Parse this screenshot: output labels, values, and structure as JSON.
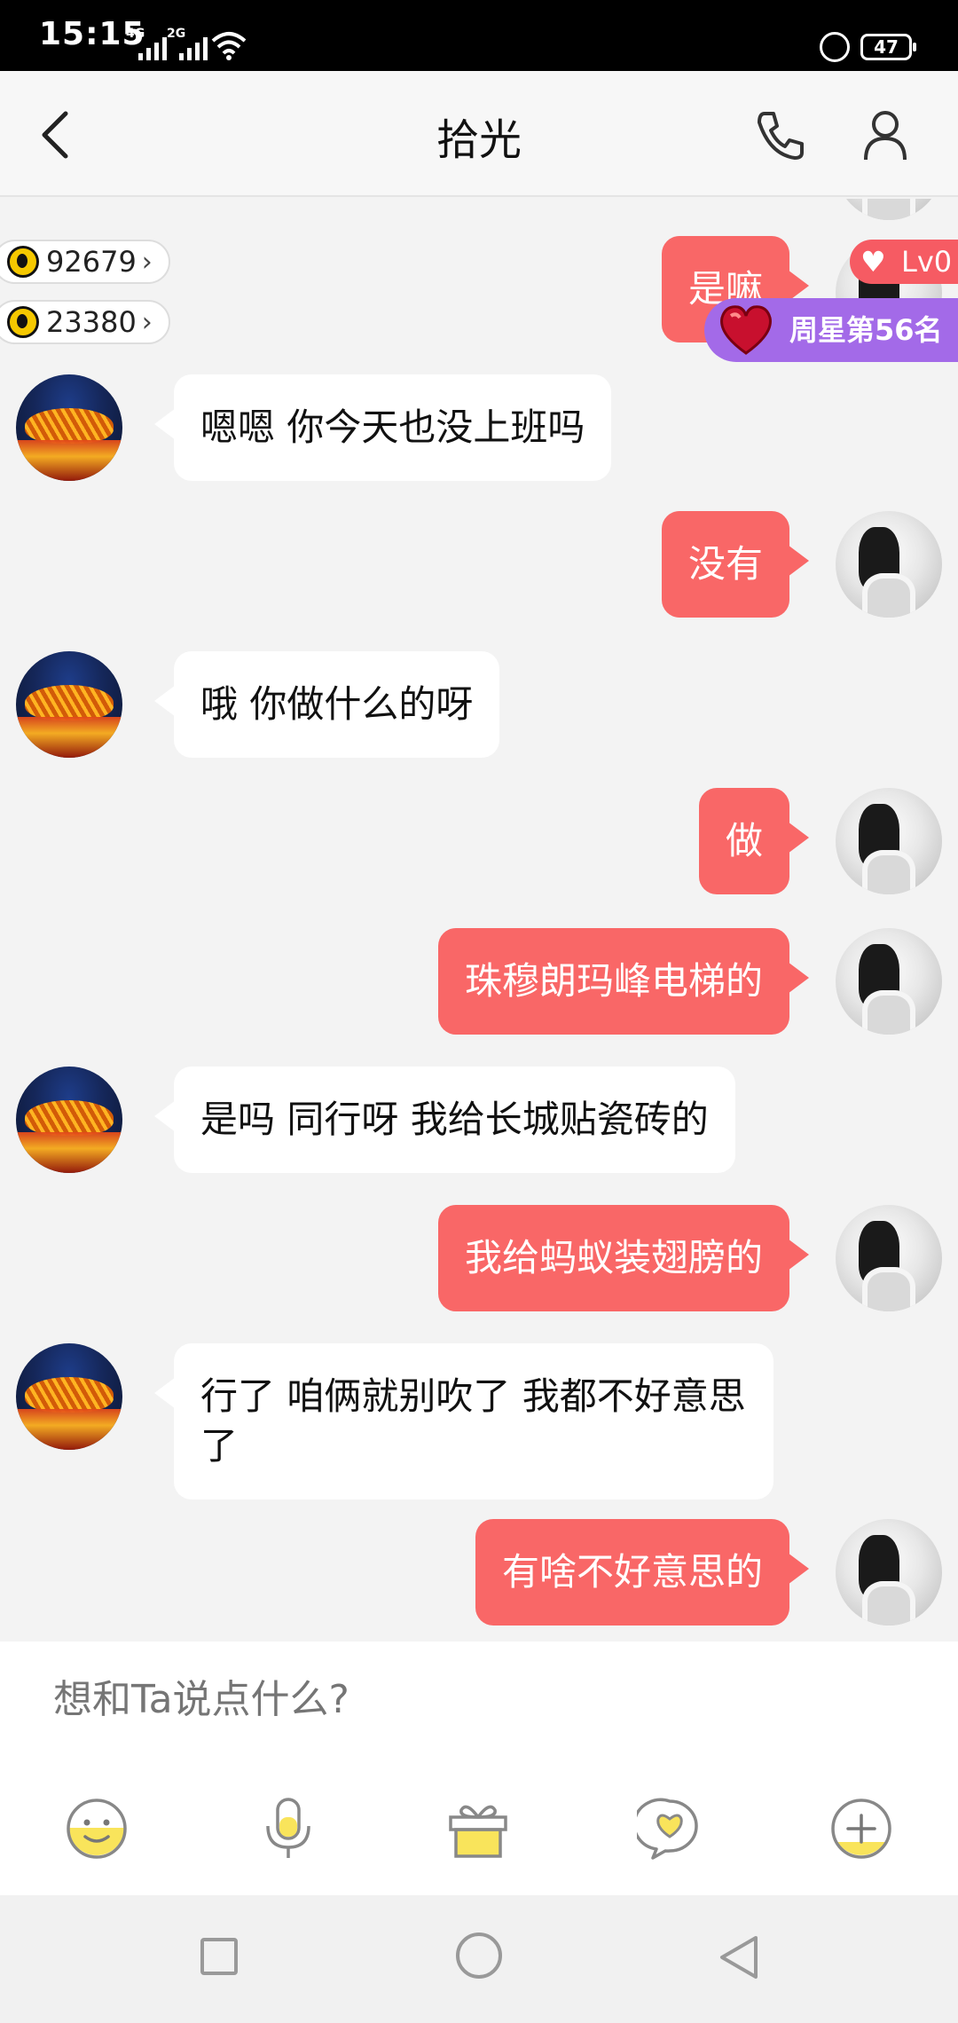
{
  "status_bar": {
    "time": "15:15",
    "network1": "4G",
    "network2": "2G",
    "battery": "47"
  },
  "header": {
    "title": "拾光",
    "icons": [
      "back-icon",
      "phone-icon",
      "profile-icon"
    ]
  },
  "badges": {
    "coins": "92679",
    "scholar": "23380",
    "level": "Lv0",
    "rank": "周星第56名"
  },
  "messages": [
    {
      "side": "out",
      "text": "是嘛"
    },
    {
      "side": "in",
      "text": "嗯嗯  你今天也没上班吗"
    },
    {
      "side": "out",
      "text": "没有"
    },
    {
      "side": "in",
      "text": "哦 你做什么的呀"
    },
    {
      "side": "out",
      "text": "做"
    },
    {
      "side": "out",
      "text": "珠穆朗玛峰电梯的"
    },
    {
      "side": "in",
      "text": "是吗  同行呀  我给长城贴瓷砖的"
    },
    {
      "side": "out",
      "text": "我给蚂蚁装翅膀的"
    },
    {
      "side": "in",
      "text": "行了  咱俩就别吹了  我都不好意思了"
    },
    {
      "side": "out",
      "text": "有啥不好意思的"
    }
  ],
  "input": {
    "placeholder": "想和Ta说点什么?"
  },
  "toolbar": [
    "emoji-icon",
    "microphone-icon",
    "gift-icon",
    "heart-chat-icon",
    "plus-icon"
  ],
  "colors": {
    "outgoing_bubble": "#f96767",
    "incoming_bubble": "#ffffff",
    "accent_yellow": "#f9e45b",
    "rank_badge": "#a36ae8"
  }
}
